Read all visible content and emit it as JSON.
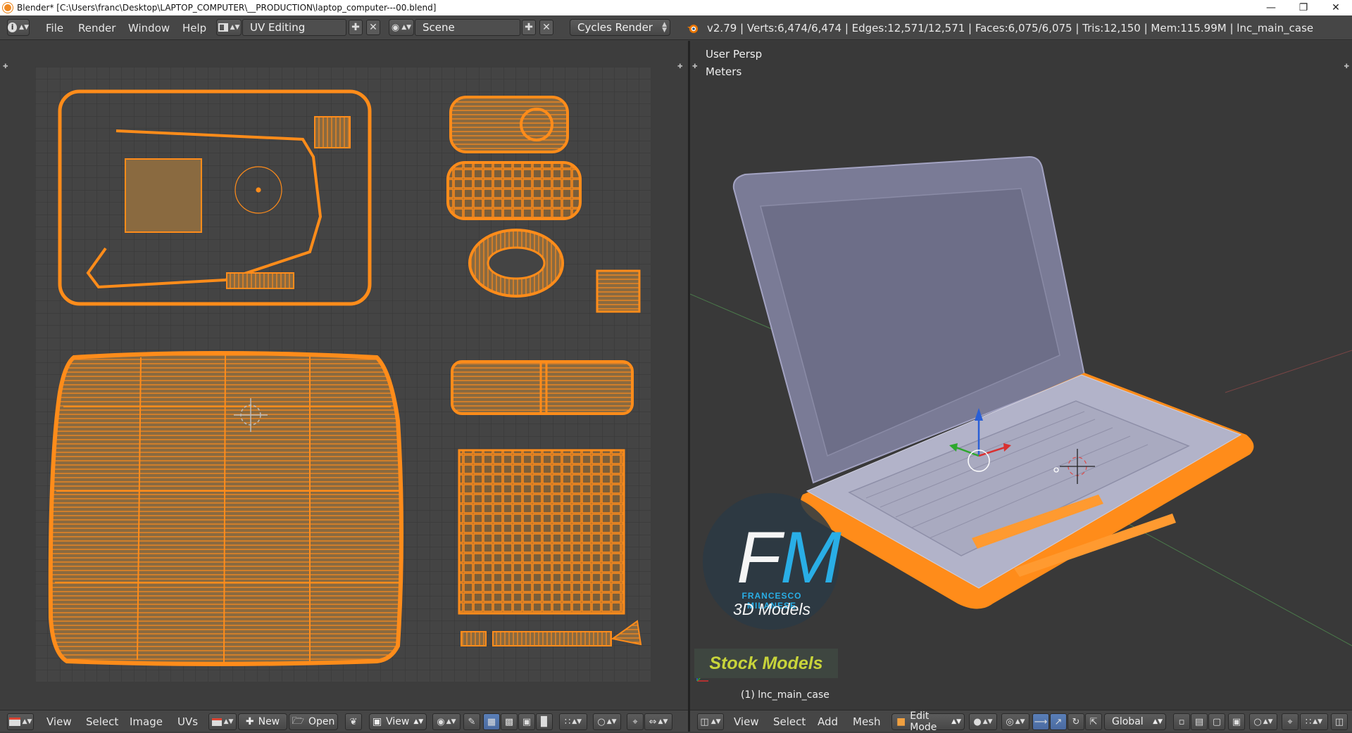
{
  "window": {
    "title": "Blender* [C:\\Users\\franc\\Desktop\\LAPTOP_COMPUTER\\__PRODUCTION\\laptop_computer---00.blend]",
    "min_icon": "minimize-icon",
    "max_icon": "restore-icon",
    "close_icon": "close-icon"
  },
  "topbar": {
    "menus": [
      "File",
      "Render",
      "Window",
      "Help"
    ],
    "screen_layout": "UV Editing",
    "scene": "Scene",
    "render_engine": "Cycles Render",
    "stats": "v2.79 | Verts:6,474/6,474 | Edges:12,571/12,571 | Faces:6,075/6,075 | Tris:12,150 | Mem:115.99M | lnc_main_case"
  },
  "uv_editor": {
    "menus": [
      "View",
      "Select",
      "Image",
      "UVs"
    ],
    "new_label": "New",
    "open_label": "Open",
    "view_label": "View",
    "colors": {
      "grid_bg": "#444444",
      "uv_edge": "#ff8c1a",
      "uv_face": "#8a6a40"
    }
  },
  "viewport": {
    "view_name": "User Persp",
    "units": "Meters",
    "object_label": "(1) lnc_main_case",
    "menus": [
      "View",
      "Select",
      "Add",
      "Mesh"
    ],
    "mode": "Edit Mode",
    "orientation": "Global"
  },
  "watermark": {
    "logo_letters": "FM",
    "author": "FRANCESCO MILANESE",
    "subtitle": "3D Models",
    "badge": "Stock Models"
  }
}
